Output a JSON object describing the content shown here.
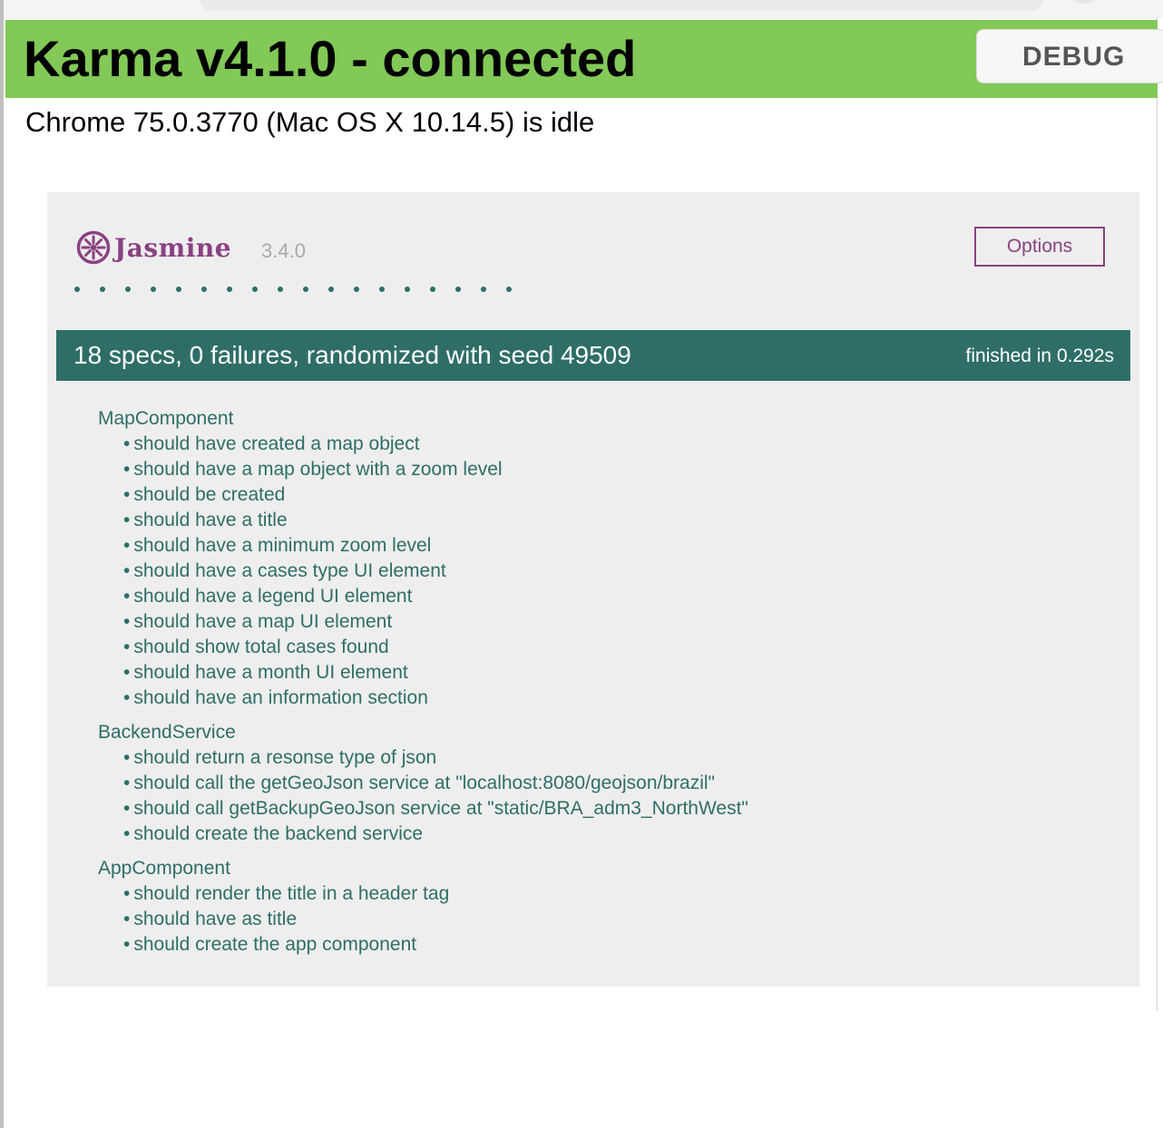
{
  "karma": {
    "title": "Karma v4.1.0 - connected",
    "debug_label": "DEBUG",
    "browser_status": "Chrome 75.0.3770 (Mac OS X 10.14.5) is idle",
    "banner_color": "#82c957"
  },
  "jasmine": {
    "brand": "Jasmine",
    "version": "3.4.0",
    "options_label": "Options",
    "accent_color": "#8a4182",
    "pass_color": "#2e6e66",
    "spec_symbol_count": 18,
    "summary": {
      "text": "18 specs, 0 failures, randomized with seed 49509",
      "duration": "finished in 0.292s"
    },
    "suites": [
      {
        "name": "MapComponent",
        "specs": [
          "should have created a map object",
          "should have a map object with a zoom level",
          "should be created",
          "should have a title",
          "should have a minimum zoom level",
          "should have a cases type UI element",
          "should have a legend UI element",
          "should have a map UI element",
          "should show total cases found",
          "should have a month UI element",
          "should have an information section"
        ]
      },
      {
        "name": "BackendService",
        "specs": [
          "should return a resonse type of json",
          "should call the getGeoJson service at \"localhost:8080/geojson/brazil\"",
          "should call getBackupGeoJson service at \"static/BRA_adm3_NorthWest\"",
          "should create the backend service"
        ]
      },
      {
        "name": "AppComponent",
        "specs": [
          "should render the title in a header tag",
          "should have as title",
          "should create the app component"
        ]
      }
    ]
  }
}
